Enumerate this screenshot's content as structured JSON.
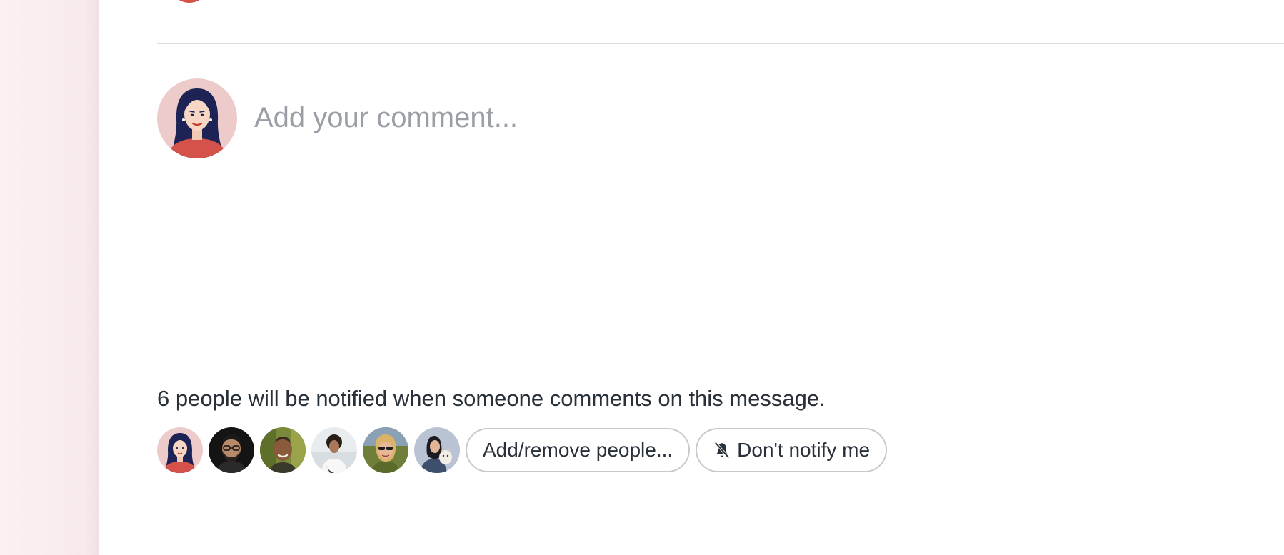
{
  "composer": {
    "placeholder": "Add your comment..."
  },
  "notifications": {
    "summary": "6 people will be notified when someone comments on this message.",
    "subscriber_count": 6,
    "add_remove_label": "Add/remove people...",
    "dont_notify_label": "Don't notify me",
    "dont_notify_icon": "bell-slash-icon"
  },
  "colors": {
    "left_rail_bg": "#f8eaea",
    "accent_red": "#d5524a",
    "text": "#283039",
    "placeholder": "#9a9ea6",
    "divider": "#dcdcdc"
  }
}
